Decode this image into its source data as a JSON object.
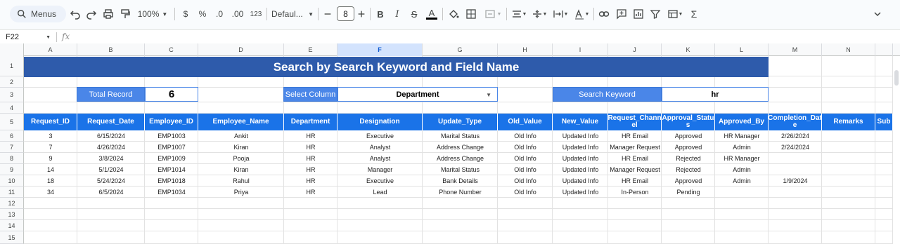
{
  "toolbar": {
    "menus_label": "Menus",
    "zoom": "100%",
    "currency": "$",
    "percent": "%",
    "decrease_decimals": ".0",
    "increase_decimals": ".00",
    "number_format": "123",
    "font_name": "Defaul...",
    "font_size": "8"
  },
  "formula_bar": {
    "cell_ref": "F22",
    "fx": "fx",
    "content": ""
  },
  "columns": [
    "A",
    "B",
    "C",
    "D",
    "E",
    "F",
    "G",
    "H",
    "I",
    "J",
    "K",
    "L",
    "M",
    "N",
    ""
  ],
  "selected_column": "F",
  "rows": [
    "1",
    "2",
    "3",
    "4",
    "5",
    "6",
    "7",
    "8",
    "9",
    "10",
    "11",
    "12",
    "13",
    "14",
    "15"
  ],
  "sheet": {
    "title": "Search by Search Keyword and Field Name",
    "total_record_label": "Total Record",
    "total_record_value": "6",
    "select_column_label": "Select Column",
    "select_column_value": "Department",
    "search_keyword_label": "Search Keyword",
    "search_keyword_value": "hr"
  },
  "table": {
    "headers": [
      "Request_ID",
      "Request_Date",
      "Employee_ID",
      "Employee_Name",
      "Department",
      "Designation",
      "Update_Type",
      "Old_Value",
      "New_Value",
      "Request_Chann el",
      "Approval_Statu s",
      "Approved_By",
      "Completion_Dat e",
      "Remarks",
      "Sub"
    ],
    "rows": [
      [
        "3",
        "6/15/2024",
        "EMP1003",
        "Ankit",
        "HR",
        "Executive",
        "Marital Status",
        "Old Info",
        "Updated Info",
        "HR Email",
        "Approved",
        "HR Manager",
        "2/26/2024",
        "",
        ""
      ],
      [
        "7",
        "4/26/2024",
        "EMP1007",
        "Kiran",
        "HR",
        "Analyst",
        "Address Change",
        "Old Info",
        "Updated Info",
        "Manager Request",
        "Approved",
        "Admin",
        "2/24/2024",
        "",
        ""
      ],
      [
        "9",
        "3/8/2024",
        "EMP1009",
        "Pooja",
        "HR",
        "Analyst",
        "Address Change",
        "Old Info",
        "Updated Info",
        "HR Email",
        "Rejected",
        "HR Manager",
        "",
        "",
        ""
      ],
      [
        "14",
        "5/1/2024",
        "EMP1014",
        "Kiran",
        "HR",
        "Manager",
        "Marital Status",
        "Old Info",
        "Updated Info",
        "Manager Request",
        "Rejected",
        "Admin",
        "",
        "",
        ""
      ],
      [
        "18",
        "5/24/2024",
        "EMP1018",
        "Rahul",
        "HR",
        "Executive",
        "Bank Details",
        "Old Info",
        "Updated Info",
        "HR Email",
        "Approved",
        "Admin",
        "1/9/2024",
        "",
        ""
      ],
      [
        "34",
        "6/5/2024",
        "EMP1034",
        "Priya",
        "HR",
        "Lead",
        "Phone Number",
        "Old Info",
        "Updated Info",
        "In-Person",
        "Pending",
        "",
        "",
        "",
        ""
      ]
    ]
  },
  "colors": {
    "title_bg": "#2e5bab",
    "label_bg": "#4a86e8",
    "header_bg": "#1a73e8",
    "selected_col_bg": "#d3e3fd"
  }
}
